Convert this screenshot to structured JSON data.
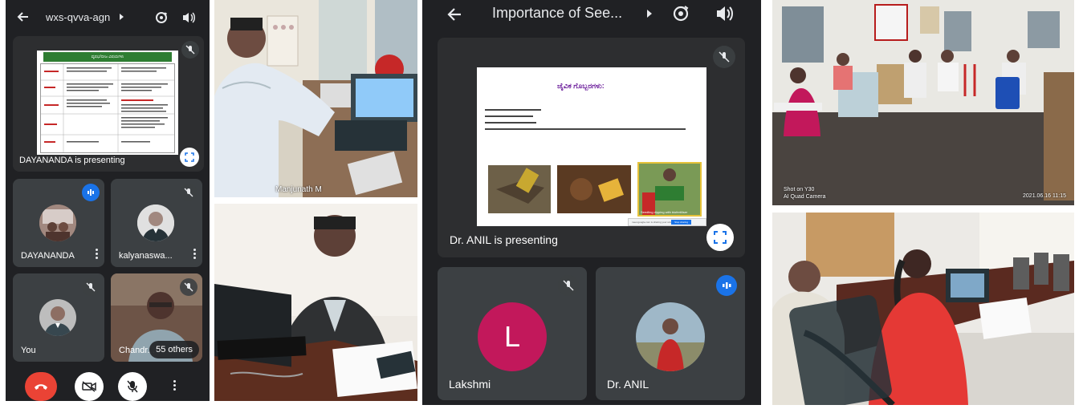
{
  "left_call": {
    "meeting_code": "wxs-qvva-agn",
    "presenter_label": "DAYANANDA is presenting",
    "tiles": [
      {
        "name": "DAYANANDA",
        "state": "talking"
      },
      {
        "name": "kalyanaswa...",
        "state": "muted"
      },
      {
        "name": "You",
        "state": "muted"
      },
      {
        "name": "Chandr...",
        "state": "muted"
      }
    ],
    "others_count": "55 others",
    "slide_title": "ವೃಷಭ/ಬೀಜ ವಿಷಯಗಳು",
    "colors": {
      "bg": "#202124",
      "tile": "#3c4043",
      "hangup": "#ea4335",
      "accent": "#1a73e8"
    }
  },
  "photo_top": {
    "caption": "Manjunath M"
  },
  "right_call": {
    "meeting_title": "Importance of See...",
    "presenter_label": "Dr. ANIL is presenting",
    "slide_title": "ಜೈವಿಕ ಗೊಬ್ಬರಗಳು:",
    "slide_image_caption": "Seedling dipping with biofertiliser",
    "slide_bar_text": "meet.google.com is sharing your screen",
    "slide_bar_button": "Stop sharing",
    "tiles": [
      {
        "name": "Lakshmi",
        "initial": "L",
        "state": "muted",
        "avatar_color": "#c2185b"
      },
      {
        "name": "Dr. ANIL",
        "state": "talking"
      }
    ]
  },
  "photo_room": {
    "watermark_line1": "Shot on Y30",
    "watermark_line2": "AI Quad Camera",
    "timestamp": "2021.06.16 11:15"
  }
}
